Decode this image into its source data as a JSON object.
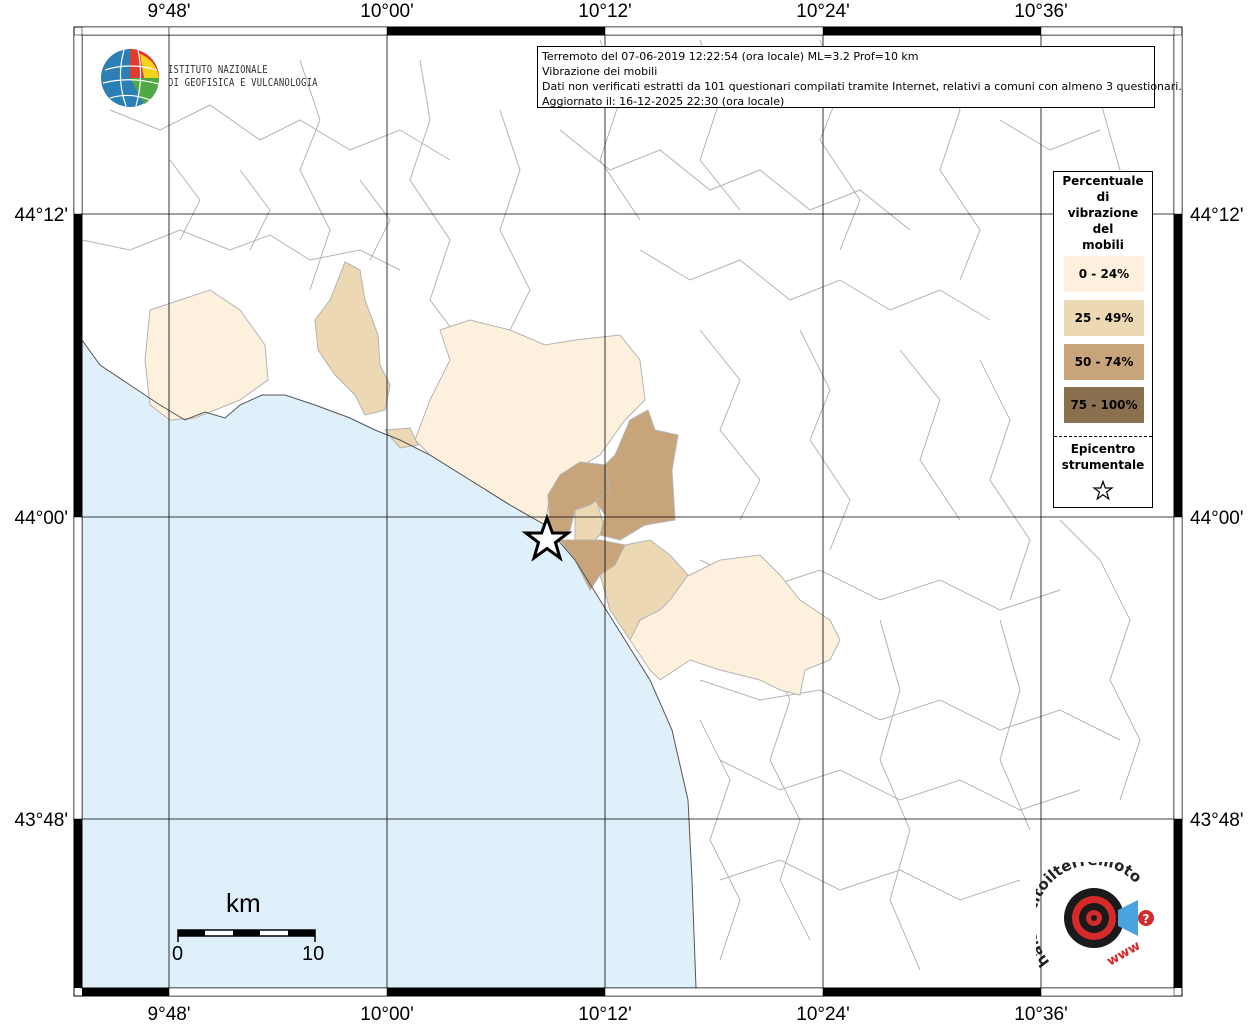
{
  "info": {
    "line1": "Terremoto del 07-06-2019 12:22:54 (ora locale) ML=3.2 Prof=10 km",
    "line2": "Vibrazione dei mobili",
    "line3": "Dati non verificati estratti da 101 questionari compilati tramite Internet, relativi a comuni con almeno 3 questionari.",
    "line4": "Aggiornato il: 16-12-2025 22:30 (ora locale)"
  },
  "ingv": {
    "line1": "ISTITUTO NAZIONALE",
    "line2": "DI GEOFISICA E VULCANOLOGIA"
  },
  "axes": {
    "lon_labels": [
      "9°48'",
      "10°00'",
      "10°12'",
      "10°24'",
      "10°36'"
    ],
    "lat_labels": [
      "44°12'",
      "44°00'",
      "43°48'"
    ]
  },
  "legend": {
    "title_lines": [
      "Percentuale",
      "di",
      "vibrazione",
      "del",
      "mobili"
    ],
    "classes": [
      {
        "label": "0 - 24%",
        "color": "#fdf0dd"
      },
      {
        "label": "25 - 49%",
        "color": "#ecd9b3"
      },
      {
        "label": "50 - 74%",
        "color": "#c8a47a"
      },
      {
        "label": "75 - 100%",
        "color": "#8b7050"
      }
    ],
    "epicenter_lines": [
      "Epicentro",
      "strumentale"
    ]
  },
  "scale": {
    "unit": "km",
    "start": "0",
    "end": "10"
  },
  "colors": {
    "sea": "#dff0fb",
    "grid": "#000000",
    "borders": "#b4b4b4"
  },
  "hst_logo": {
    "text": "haisentitoilterremoto.it",
    "url": "www"
  }
}
